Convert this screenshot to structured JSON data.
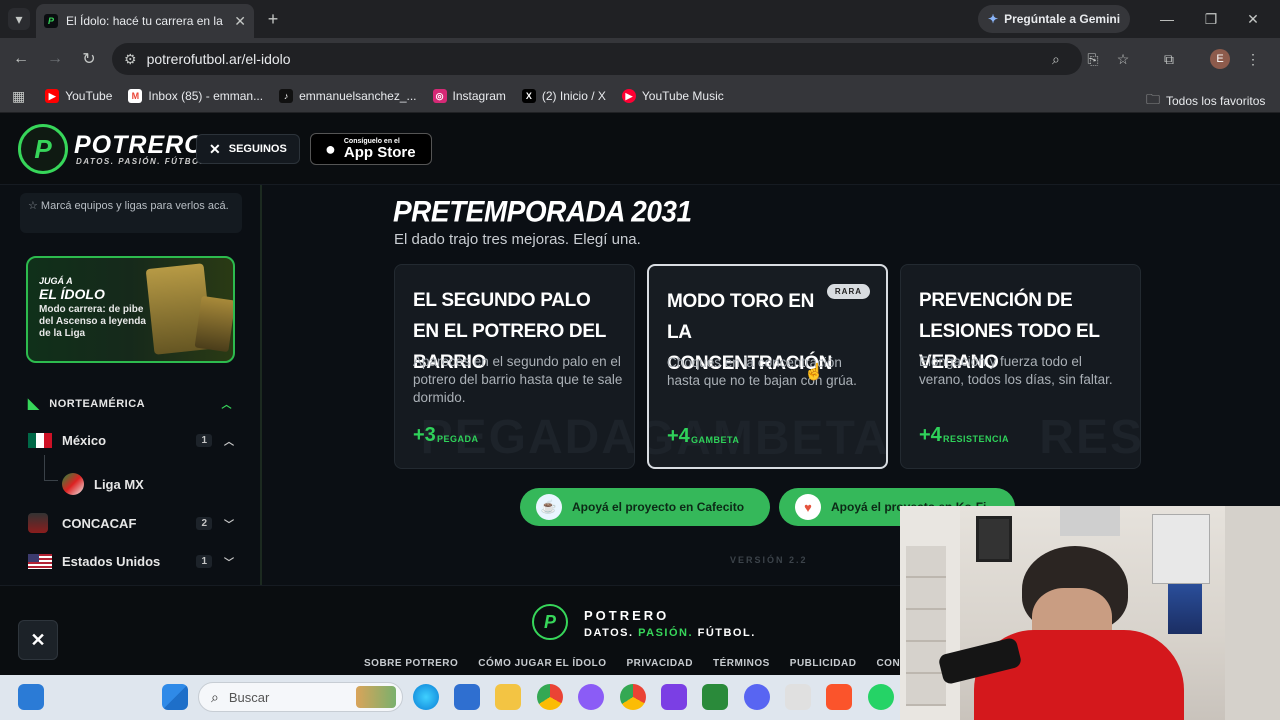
{
  "browser": {
    "tab_title": "El Ídolo: hacé tu carrera en la Liga",
    "gemini_label": "Pregúntale a Gemini",
    "url": "potrerofutbol.ar/el-idolo",
    "profile_initial": "E",
    "bookmarks": [
      {
        "label": "YouTube",
        "color": "#ff0000"
      },
      {
        "label": "Inbox (85) - emman...",
        "color": "#ea4335"
      },
      {
        "label": "emmanuelsanchez_...",
        "color": "#111111"
      },
      {
        "label": "Instagram",
        "color": "#d62976"
      },
      {
        "label": "(2) Inicio / X",
        "color": "#000000"
      },
      {
        "label": "YouTube Music",
        "color": "#ff0033"
      }
    ],
    "all_bookmarks": "Todos los favoritos"
  },
  "site": {
    "logo_title": "POTRERO",
    "logo_sub": "DATOS. PASIÓN. FÚTBOL.",
    "follow_label": "SEGUINOS",
    "appstore_small": "Consíguelo en el",
    "appstore_big": "App Store"
  },
  "sidebar": {
    "fav_hint": "Marcá equipos y ligas para verlos acá.",
    "promo": {
      "line1": "JUGÁ A",
      "line2": "EL ÍDOLO",
      "line3": "Modo carrera: de pibe del Ascenso a leyenda de la Liga"
    },
    "region": "NORTEAMÉRICA",
    "items": [
      {
        "name": "México",
        "count": "1"
      },
      {
        "name": "Liga MX"
      },
      {
        "name": "CONCACAF",
        "count": "2"
      },
      {
        "name": "Estados Unidos",
        "count": "1"
      }
    ]
  },
  "main": {
    "title": "PRETEMPORADA 2031",
    "subtitle": "El dado trajo tres mejoras. Elegí una.",
    "cards": [
      {
        "title": "EL SEGUNDO PALO EN EL POTRERO DEL BARRIO",
        "desc": "Aparecés en el segundo palo en el potrero del barrio hasta que te sale dormido.",
        "plus": "+3",
        "stat": "PEGADA",
        "watermark": "PEGADA"
      },
      {
        "title": "MODO TORO EN LA CONCENTRACIÓN",
        "badge": "RARA",
        "desc": "Choques en la concentración hasta que no te bajan con grúa.",
        "plus": "+4",
        "stat": "GAMBETA",
        "watermark": "GAMBETA"
      },
      {
        "title": "PREVENCIÓN DE LESIONES TODO EL VERANO",
        "desc": "Elongación y fuerza todo el verano, todos los días, sin faltar.",
        "plus": "+4",
        "stat": "RESISTENCIA",
        "watermark": "RES"
      }
    ],
    "donate_cafecito": "Apoyá el proyecto en Cafecito",
    "donate_kofi": "Apoyá el proyecto en Ko-Fi",
    "version": "VERSIÓN 2.2"
  },
  "footer": {
    "title": "POTRERO",
    "sub_a": "DATOS.",
    "sub_b": "PASIÓN.",
    "sub_c": "FÚTBOL.",
    "links": [
      "SOBRE POTRERO",
      "CÓMO JUGAR EL ÍDOLO",
      "PRIVACIDAD",
      "TÉRMINOS",
      "PUBLICIDAD",
      "CONTACTO"
    ]
  },
  "taskbar": {
    "search_placeholder": "Buscar"
  }
}
